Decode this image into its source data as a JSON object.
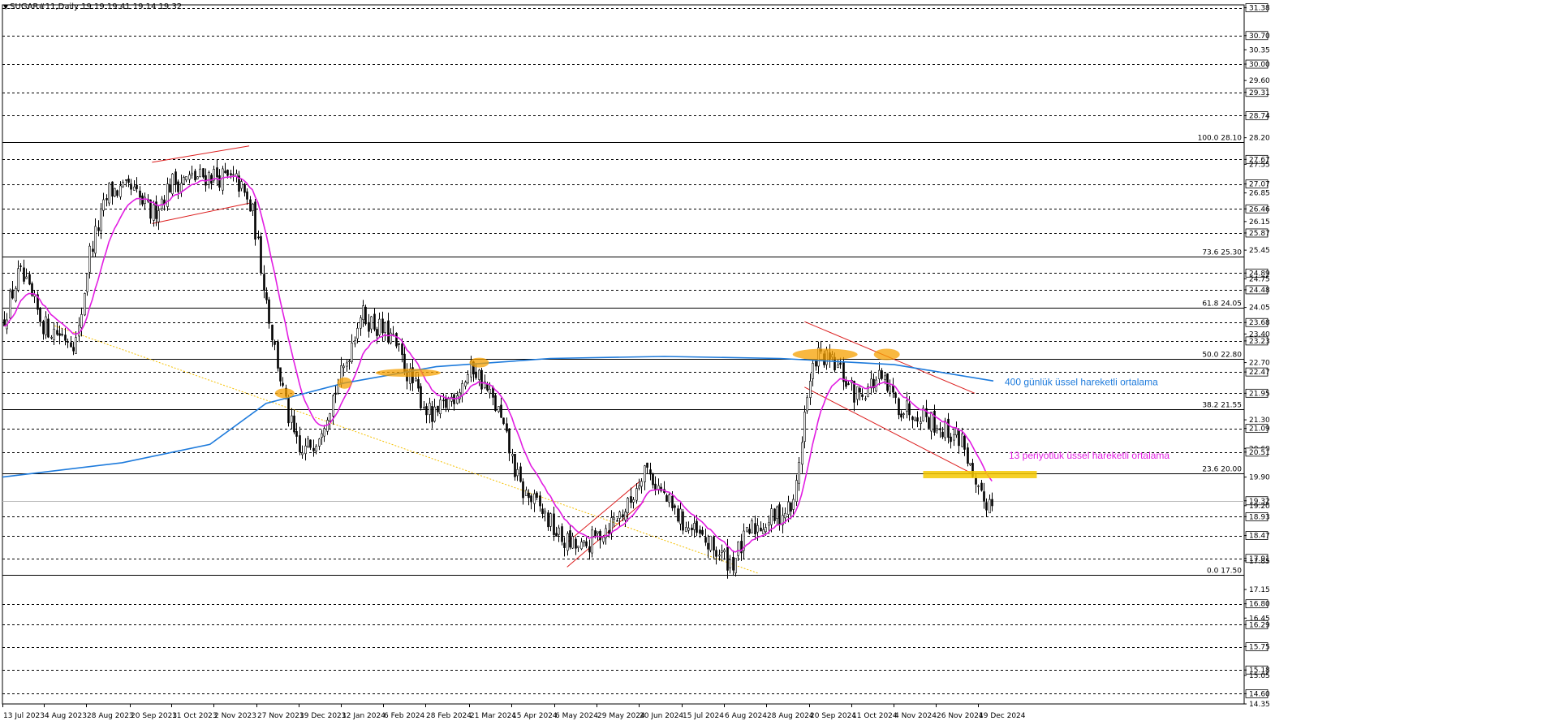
{
  "header": {
    "symbol_line": "SUGAR#11,Daily  19.19 19.41 19.14 19.32"
  },
  "colors": {
    "background": "#ffffff",
    "candle": "#000000",
    "ema13": "#e21ee2",
    "ema400": "#1e7bdc",
    "channel": "#dc1e1e",
    "highlight_orange": "#f5a000",
    "highlight_yellow": "#f5c800",
    "trend_dotted": "#f5c000",
    "grid": "#000000"
  },
  "chart_data": {
    "type": "candlestick",
    "instrument": "SUGAR#11",
    "timeframe": "Daily",
    "last_bar": {
      "open": 19.19,
      "high": 19.41,
      "low": 19.14,
      "close": 19.32
    },
    "y_range": [
      14.35,
      31.45
    ],
    "y_axis_labels": [
      {
        "value": 31.38,
        "text": "31.38",
        "boxed": true
      },
      {
        "value": 30.7,
        "text": "30.70",
        "boxed": true
      },
      {
        "value": 30.35,
        "text": "30.35",
        "boxed": false
      },
      {
        "value": 30.0,
        "text": "30.00",
        "boxed": true
      },
      {
        "value": 29.6,
        "text": "29.60",
        "boxed": false
      },
      {
        "value": 29.31,
        "text": "29.31",
        "boxed": true
      },
      {
        "value": 28.74,
        "text": "28.74",
        "boxed": true
      },
      {
        "value": 28.2,
        "text": "28.20",
        "boxed": false
      },
      {
        "value": 27.67,
        "text": "27.67",
        "boxed": true
      },
      {
        "value": 27.55,
        "text": "27.55",
        "boxed": false
      },
      {
        "value": 27.07,
        "text": "27.07",
        "boxed": true
      },
      {
        "value": 26.85,
        "text": "26.85",
        "boxed": false
      },
      {
        "value": 26.46,
        "text": "26.46",
        "boxed": true
      },
      {
        "value": 26.15,
        "text": "26.15",
        "boxed": false
      },
      {
        "value": 25.87,
        "text": "25.87",
        "boxed": true
      },
      {
        "value": 25.45,
        "text": "25.45",
        "boxed": false
      },
      {
        "value": 24.89,
        "text": "24.89",
        "boxed": true
      },
      {
        "value": 24.75,
        "text": "24.75",
        "boxed": false
      },
      {
        "value": 24.48,
        "text": "24.48",
        "boxed": true
      },
      {
        "value": 24.05,
        "text": "24.05",
        "boxed": false
      },
      {
        "value": 23.68,
        "text": "23.68",
        "boxed": true
      },
      {
        "value": 23.4,
        "text": "23.40",
        "boxed": false
      },
      {
        "value": 23.23,
        "text": "23.23",
        "boxed": true
      },
      {
        "value": 22.7,
        "text": "22.70",
        "boxed": false
      },
      {
        "value": 22.47,
        "text": "22.47",
        "boxed": true
      },
      {
        "value": 21.95,
        "text": "21.95",
        "boxed": true
      },
      {
        "value": 21.3,
        "text": "21.30",
        "boxed": false
      },
      {
        "value": 21.09,
        "text": "21.09",
        "boxed": true
      },
      {
        "value": 20.6,
        "text": "20.60",
        "boxed": false
      },
      {
        "value": 20.51,
        "text": "20.51",
        "boxed": true
      },
      {
        "value": 19.9,
        "text": "19.90",
        "boxed": false
      },
      {
        "value": 19.32,
        "text": "19.32",
        "boxed": true
      },
      {
        "value": 19.2,
        "text": "19.20",
        "boxed": false
      },
      {
        "value": 18.93,
        "text": "18.93",
        "boxed": true
      },
      {
        "value": 18.47,
        "text": "18.47",
        "boxed": true
      },
      {
        "value": 17.91,
        "text": "17.91",
        "boxed": true
      },
      {
        "value": 17.85,
        "text": "17.85",
        "boxed": false
      },
      {
        "value": 17.15,
        "text": "17.15",
        "boxed": false
      },
      {
        "value": 16.8,
        "text": "16.80",
        "boxed": true
      },
      {
        "value": 16.45,
        "text": "16.45",
        "boxed": false
      },
      {
        "value": 16.29,
        "text": "16.29",
        "boxed": true
      },
      {
        "value": 15.75,
        "text": "15.75",
        "boxed": true
      },
      {
        "value": 15.18,
        "text": "15.18",
        "boxed": true
      },
      {
        "value": 15.05,
        "text": "15.05",
        "boxed": false
      },
      {
        "value": 14.6,
        "text": "14.60",
        "boxed": true
      },
      {
        "value": 14.35,
        "text": "14.35",
        "boxed": false
      }
    ],
    "dashed_levels": [
      31.38,
      30.7,
      30.0,
      29.31,
      28.74,
      27.67,
      27.07,
      26.46,
      25.87,
      24.89,
      24.48,
      23.68,
      23.23,
      22.47,
      21.95,
      21.09,
      20.51,
      18.93,
      18.47,
      17.91,
      16.8,
      16.29,
      15.75,
      15.18,
      14.6
    ],
    "fibonacci_levels": [
      {
        "label": "100.0 28.10",
        "value": 28.1
      },
      {
        "label": "73.6 25.30",
        "value": 25.3
      },
      {
        "label": "61.8 24.05",
        "value": 24.05
      },
      {
        "label": "50.0 22.80",
        "value": 22.8
      },
      {
        "label": "38.2 21.55",
        "value": 21.55
      },
      {
        "label": "23.6 20.00",
        "value": 20.0
      },
      {
        "label": "0.0 17.50",
        "value": 17.5
      }
    ],
    "current_price_line": 19.32,
    "x_labels": [
      "13 Jul 2023",
      "4 Aug 2023",
      "28 Aug 2023",
      "20 Sep 2023",
      "11 Oct 2023",
      "2 Nov 2023",
      "27 Nov 2023",
      "19 Dec 2023",
      "12 Jan 2024",
      "6 Feb 2024",
      "28 Feb 2024",
      "21 Mar 2024",
      "15 Apr 2024",
      "6 May 2024",
      "29 May 2024",
      "20 Jun 2024",
      "15 Jul 2024",
      "6 Aug 2024",
      "28 Aug 2024",
      "20 Sep 2024",
      "11 Oct 2024",
      "4 Nov 2024",
      "26 Nov 2024",
      "19 Dec 2024"
    ],
    "price_path": [
      {
        "date": "13 Jul 2023",
        "close": 23.7
      },
      {
        "date": "22 Jul 2023",
        "close": 24.9
      },
      {
        "date": "4 Aug 2023",
        "close": 23.6
      },
      {
        "date": "22 Aug 2023",
        "close": 23.2
      },
      {
        "date": "28 Aug 2023",
        "close": 25.3
      },
      {
        "date": "8 Sep 2023",
        "close": 26.9
      },
      {
        "date": "20 Sep 2023",
        "close": 26.9
      },
      {
        "date": "1 Oct 2023",
        "close": 26.3
      },
      {
        "date": "11 Oct 2023",
        "close": 27.1
      },
      {
        "date": "2 Nov 2023",
        "close": 27.3
      },
      {
        "date": "16 Nov 2023",
        "close": 27.1
      },
      {
        "date": "24 Nov 2023",
        "close": 26.3
      },
      {
        "date": "4 Dec 2023",
        "close": 23.4
      },
      {
        "date": "12 Dec 2023",
        "close": 21.5
      },
      {
        "date": "19 Dec 2023",
        "close": 20.4
      },
      {
        "date": "28 Dec 2023",
        "close": 20.9
      },
      {
        "date": "12 Jan 2024",
        "close": 22.6
      },
      {
        "date": "20 Jan 2024",
        "close": 23.9
      },
      {
        "date": "6 Feb 2024",
        "close": 23.3
      },
      {
        "date": "16 Feb 2024",
        "close": 22.3
      },
      {
        "date": "28 Feb 2024",
        "close": 21.3
      },
      {
        "date": "10 Mar 2024",
        "close": 21.9
      },
      {
        "date": "21 Mar 2024",
        "close": 22.6
      },
      {
        "date": "3 Apr 2024",
        "close": 21.5
      },
      {
        "date": "15 Apr 2024",
        "close": 19.6
      },
      {
        "date": "26 Apr 2024",
        "close": 19.1
      },
      {
        "date": "6 May 2024",
        "close": 18.4
      },
      {
        "date": "18 May 2024",
        "close": 18.1
      },
      {
        "date": "29 May 2024",
        "close": 18.6
      },
      {
        "date": "12 Jun 2024",
        "close": 19.2
      },
      {
        "date": "20 Jun 2024",
        "close": 20.2
      },
      {
        "date": "5 Jul 2024",
        "close": 19.1
      },
      {
        "date": "15 Jul 2024",
        "close": 18.6
      },
      {
        "date": "28 Jul 2024",
        "close": 18.1
      },
      {
        "date": "6 Aug 2024",
        "close": 17.8
      },
      {
        "date": "16 Aug 2024",
        "close": 18.6
      },
      {
        "date": "28 Aug 2024",
        "close": 18.9
      },
      {
        "date": "8 Sep 2024",
        "close": 19.2
      },
      {
        "date": "14 Sep 2024",
        "close": 21.5
      },
      {
        "date": "20 Sep 2024",
        "close": 22.9
      },
      {
        "date": "1 Oct 2024",
        "close": 22.6
      },
      {
        "date": "11 Oct 2024",
        "close": 21.9
      },
      {
        "date": "24 Oct 2024",
        "close": 22.3
      },
      {
        "date": "4 Nov 2024",
        "close": 21.6
      },
      {
        "date": "15 Nov 2024",
        "close": 21.5
      },
      {
        "date": "26 Nov 2024",
        "close": 21.1
      },
      {
        "date": "8 Dec 2024",
        "close": 20.8
      },
      {
        "date": "14 Dec 2024",
        "close": 19.5
      },
      {
        "date": "19 Dec 2024",
        "close": 19.3
      },
      {
        "date": "24 Dec 2024",
        "close": 19.32
      }
    ],
    "annotations": [
      {
        "text": "400 günlük üssel hareketli ortalama",
        "color": "#1e7bdc"
      },
      {
        "text": "13 periyotluk üssel hareketli ortalama",
        "color": "#e21ee2"
      }
    ]
  }
}
